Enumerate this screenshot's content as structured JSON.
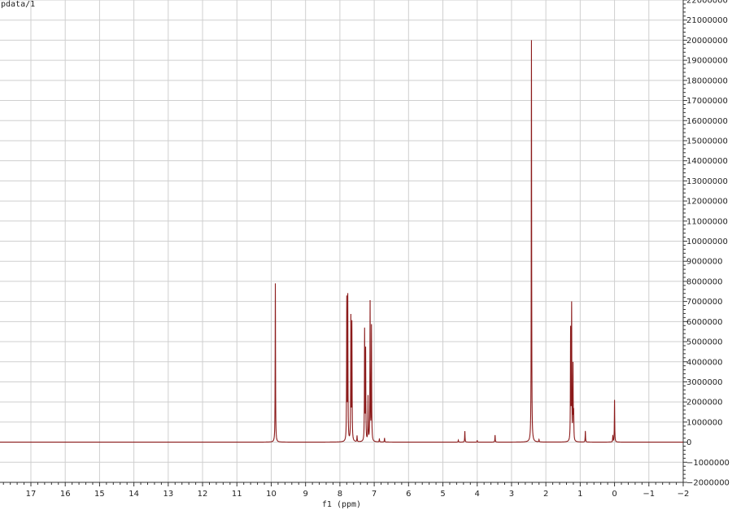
{
  "header": {
    "corner_label": "pdata/1"
  },
  "chart_data": {
    "type": "line",
    "xlabel": "f1 (ppm)",
    "xlim": [
      17.9,
      -2.0
    ],
    "ylim": [
      -2000000,
      22000000
    ],
    "x_ticks": [
      17,
      16,
      15,
      14,
      13,
      12,
      11,
      10,
      9,
      8,
      7,
      6,
      5,
      4,
      3,
      2,
      1,
      0,
      -1,
      -2
    ],
    "y_ticks": [
      22000000,
      21000000,
      20000000,
      19000000,
      18000000,
      17000000,
      16000000,
      15000000,
      14000000,
      13000000,
      12000000,
      11000000,
      10000000,
      9000000,
      8000000,
      7000000,
      6000000,
      5000000,
      4000000,
      3000000,
      2000000,
      1000000,
      0,
      -1000000,
      -2000000
    ],
    "grid": true,
    "line_color": "#8b1a1a",
    "series": [
      {
        "peaks": [
          {
            "x": 9.88,
            "y": 7900000
          },
          {
            "x": 7.8,
            "y": 7000000
          },
          {
            "x": 7.77,
            "y": 7100000
          },
          {
            "x": 7.68,
            "y": 6100000
          },
          {
            "x": 7.65,
            "y": 5800000
          },
          {
            "x": 7.5,
            "y": 300000
          },
          {
            "x": 7.28,
            "y": 5500000
          },
          {
            "x": 7.25,
            "y": 4500000
          },
          {
            "x": 7.18,
            "y": 2200000
          },
          {
            "x": 7.12,
            "y": 6900000
          },
          {
            "x": 7.08,
            "y": 5700000
          },
          {
            "x": 6.85,
            "y": 150000
          },
          {
            "x": 6.7,
            "y": 200000
          },
          {
            "x": 4.55,
            "y": 100000
          },
          {
            "x": 4.36,
            "y": 550000
          },
          {
            "x": 4.0,
            "y": 80000
          },
          {
            "x": 3.48,
            "y": 350000
          },
          {
            "x": 2.42,
            "y": 20000000
          },
          {
            "x": 2.2,
            "y": 120000
          },
          {
            "x": 1.28,
            "y": 5500000
          },
          {
            "x": 1.25,
            "y": 6700000
          },
          {
            "x": 1.21,
            "y": 3700000
          },
          {
            "x": 1.19,
            "y": 1300000
          },
          {
            "x": 0.85,
            "y": 550000
          },
          {
            "x": 0.05,
            "y": 300000
          },
          {
            "x": 0.0,
            "y": 2100000
          }
        ]
      }
    ]
  }
}
